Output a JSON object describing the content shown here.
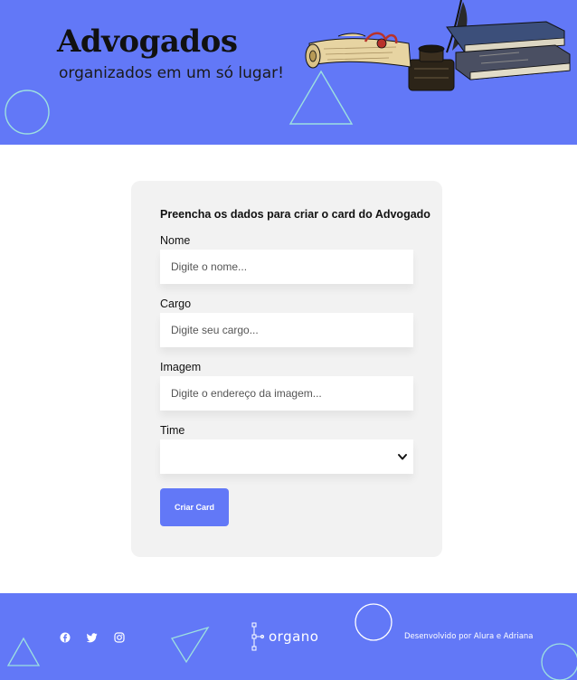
{
  "header": {
    "title": "Advogados",
    "subtitle": "organizados em um só lugar!",
    "illustration": "vintage-desk-books-inkwell-scroll"
  },
  "form": {
    "heading": "Preencha os dados para criar o card do Advogado",
    "fields": [
      {
        "label": "Nome",
        "placeholder": "Digite o nome...",
        "value": ""
      },
      {
        "label": "Cargo",
        "placeholder": "Digite seu cargo...",
        "value": ""
      },
      {
        "label": "Imagem",
        "placeholder": "Digite o endereço da imagem...",
        "value": ""
      }
    ],
    "select": {
      "label": "Time",
      "selected": "",
      "icon": "chevron-down-icon"
    },
    "submit_label": "Criar Card"
  },
  "footer": {
    "social": [
      "facebook-icon",
      "twitter-icon",
      "instagram-icon"
    ],
    "brand": "organo",
    "credits": "Desenvolvido por Alura e Adriana"
  },
  "colors": {
    "accent": "#6278F7",
    "form_bg": "#F2F2F2",
    "decoration": "#9DE0E0"
  }
}
